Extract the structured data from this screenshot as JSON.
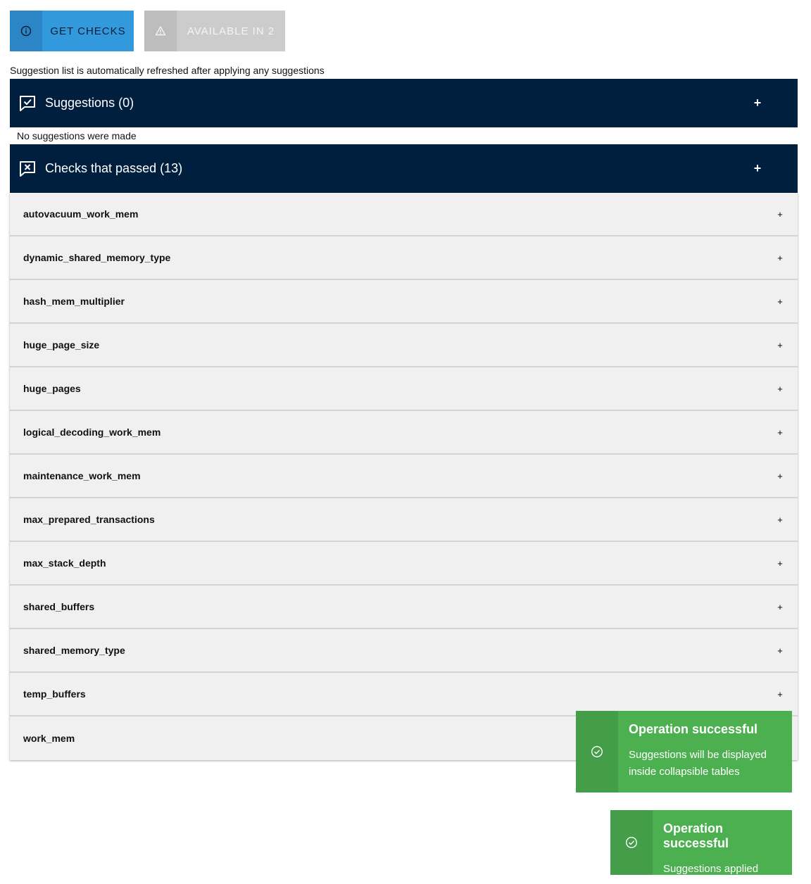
{
  "toolbar": {
    "get_checks_label": "GET CHECKS",
    "get_checks_icon": "info-icon",
    "available_label": "AVAILABLE IN 2",
    "available_icon": "warning-icon"
  },
  "info_text": "Suggestion list is automatically refreshed after applying any suggestions",
  "suggestions": {
    "title": "Suggestions (0)",
    "icon": "comment-check-icon",
    "toggle": "+",
    "empty_message": "No suggestions were made"
  },
  "passed": {
    "title": "Checks that passed (13)",
    "icon": "comment-x-icon",
    "toggle": "+",
    "items": [
      {
        "label": "autovacuum_work_mem",
        "toggle": "+"
      },
      {
        "label": "dynamic_shared_memory_type",
        "toggle": "+"
      },
      {
        "label": "hash_mem_multiplier",
        "toggle": "+"
      },
      {
        "label": "huge_page_size",
        "toggle": "+"
      },
      {
        "label": "huge_pages",
        "toggle": "+"
      },
      {
        "label": "logical_decoding_work_mem",
        "toggle": "+"
      },
      {
        "label": "maintenance_work_mem",
        "toggle": "+"
      },
      {
        "label": "max_prepared_transactions",
        "toggle": "+"
      },
      {
        "label": "max_stack_depth",
        "toggle": "+"
      },
      {
        "label": "shared_buffers",
        "toggle": "+"
      },
      {
        "label": "shared_memory_type",
        "toggle": "+"
      },
      {
        "label": "temp_buffers",
        "toggle": "+"
      },
      {
        "label": "work_mem",
        "toggle": "+"
      }
    ]
  },
  "toasts": [
    {
      "title": "Operation successful",
      "message": "Suggestions will be displayed inside collapsible tables",
      "icon": "check-circle-icon"
    },
    {
      "title": "Operation successful",
      "message": "Suggestions applied",
      "icon": "check-circle-icon"
    }
  ],
  "colors": {
    "primary": "#3399dd",
    "header_bg": "#001f3f",
    "disabled": "#cccccc",
    "success": "#4caf50",
    "row_bg": "#f0f0f0"
  }
}
